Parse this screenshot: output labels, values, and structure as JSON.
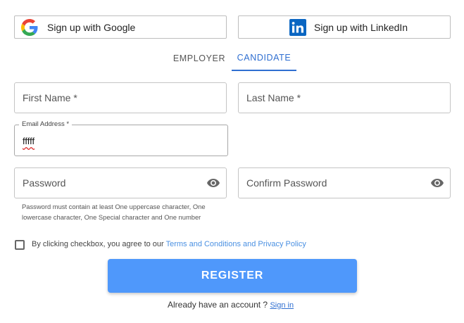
{
  "social": {
    "google_label": "Sign up with Google",
    "linkedin_label": "Sign up with LinkedIn"
  },
  "tabs": [
    {
      "label": "EMPLOYER",
      "selected": false
    },
    {
      "label": "CANDIDATE",
      "selected": true
    }
  ],
  "form": {
    "first_name_placeholder": "First Name *",
    "last_name_placeholder": "Last Name *",
    "email_label": "Email Address *",
    "email_value": "fffff",
    "password_placeholder": "Password",
    "confirm_password_placeholder": "Confirm Password",
    "password_hint": "Password must contain at least One uppercase character, One lowercase character, One Special character and One number",
    "agree_text": "By clicking checkbox, you agree to our ",
    "terms_link": "Terms and Conditions and Privacy Policy",
    "agree_checked": false
  },
  "register_label": "REGISTER",
  "footer": {
    "already_text": "Already have an account ?",
    "signin_link": "Sign in"
  },
  "colors": {
    "accent": "#2f6fd1",
    "register_bg": "#4f98fb",
    "link": "#4a90e2",
    "linkedin": "#0a66c2"
  },
  "icons": [
    "google-icon",
    "linkedin-icon",
    "eye-icon"
  ]
}
